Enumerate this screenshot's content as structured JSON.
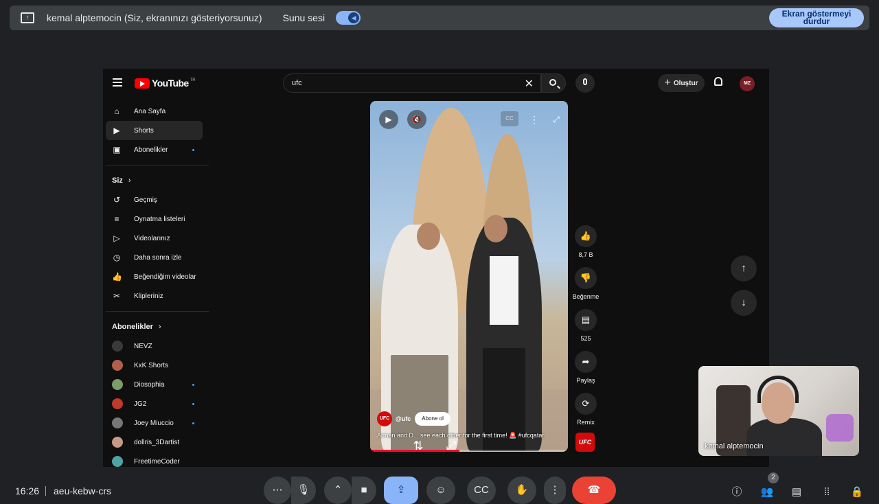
{
  "present_bar": {
    "presenting_text": "kemal alptemocin (Siz, ekranınızı gösteriyorsunuz)",
    "audio_label": "Sunu sesi",
    "stop_button": "Ekran göstermeyi durdur"
  },
  "youtube": {
    "logo_text": "YouTube",
    "logo_region": "TR",
    "search_query": "ufc",
    "create_label": "Oluştur",
    "avatar_text": "MZ",
    "sidebar": {
      "main": [
        {
          "label": "Ana Sayfa",
          "icon": "home-icon"
        },
        {
          "label": "Shorts",
          "icon": "shorts-icon"
        },
        {
          "label": "Abonelikler",
          "icon": "subscriptions-icon"
        }
      ],
      "you_heading": "Siz",
      "you_items": [
        {
          "label": "Geçmiş",
          "icon": "history-icon"
        },
        {
          "label": "Oynatma listeleri",
          "icon": "playlists-icon"
        },
        {
          "label": "Videolarınız",
          "icon": "your-videos-icon"
        },
        {
          "label": "Daha sonra izle",
          "icon": "watch-later-icon"
        },
        {
          "label": "Beğendiğim videolar",
          "icon": "liked-videos-icon"
        },
        {
          "label": "Klipleriniz",
          "icon": "clips-icon"
        }
      ],
      "subs_heading": "Abonelikler",
      "subscriptions": [
        {
          "label": "NEVZ",
          "color": "#3a3a3a"
        },
        {
          "label": "KxK Shorts",
          "color": "#b0604a"
        },
        {
          "label": "Diosophia",
          "color": "#7e9b6a"
        },
        {
          "label": "JG2",
          "color": "#c0392b"
        },
        {
          "label": "Joey Miuccio",
          "color": "#777777"
        },
        {
          "label": "dollris_3Dartist",
          "color": "#c79a86"
        },
        {
          "label": "FreetimeCoder",
          "color": "#4fa3a5"
        }
      ]
    },
    "short": {
      "channel_avatar": "UFC",
      "handle": "@ufc",
      "subscribe": "Abone ol",
      "caption": "Arman and D... see each other for the first time! 🚨 #ufcqatar",
      "progress": 0.45
    },
    "actions": {
      "likes": "8,7 B",
      "dislike": "Beğenme",
      "comments": "525",
      "share": "Paylaş",
      "remix": "Remix",
      "ufc_tile": "UFC"
    }
  },
  "self_view": {
    "name": "kemal alptemocin"
  },
  "meet_bottom": {
    "time": "16:26",
    "meeting_code": "aeu-kebw-crs",
    "participants_count": "2"
  }
}
